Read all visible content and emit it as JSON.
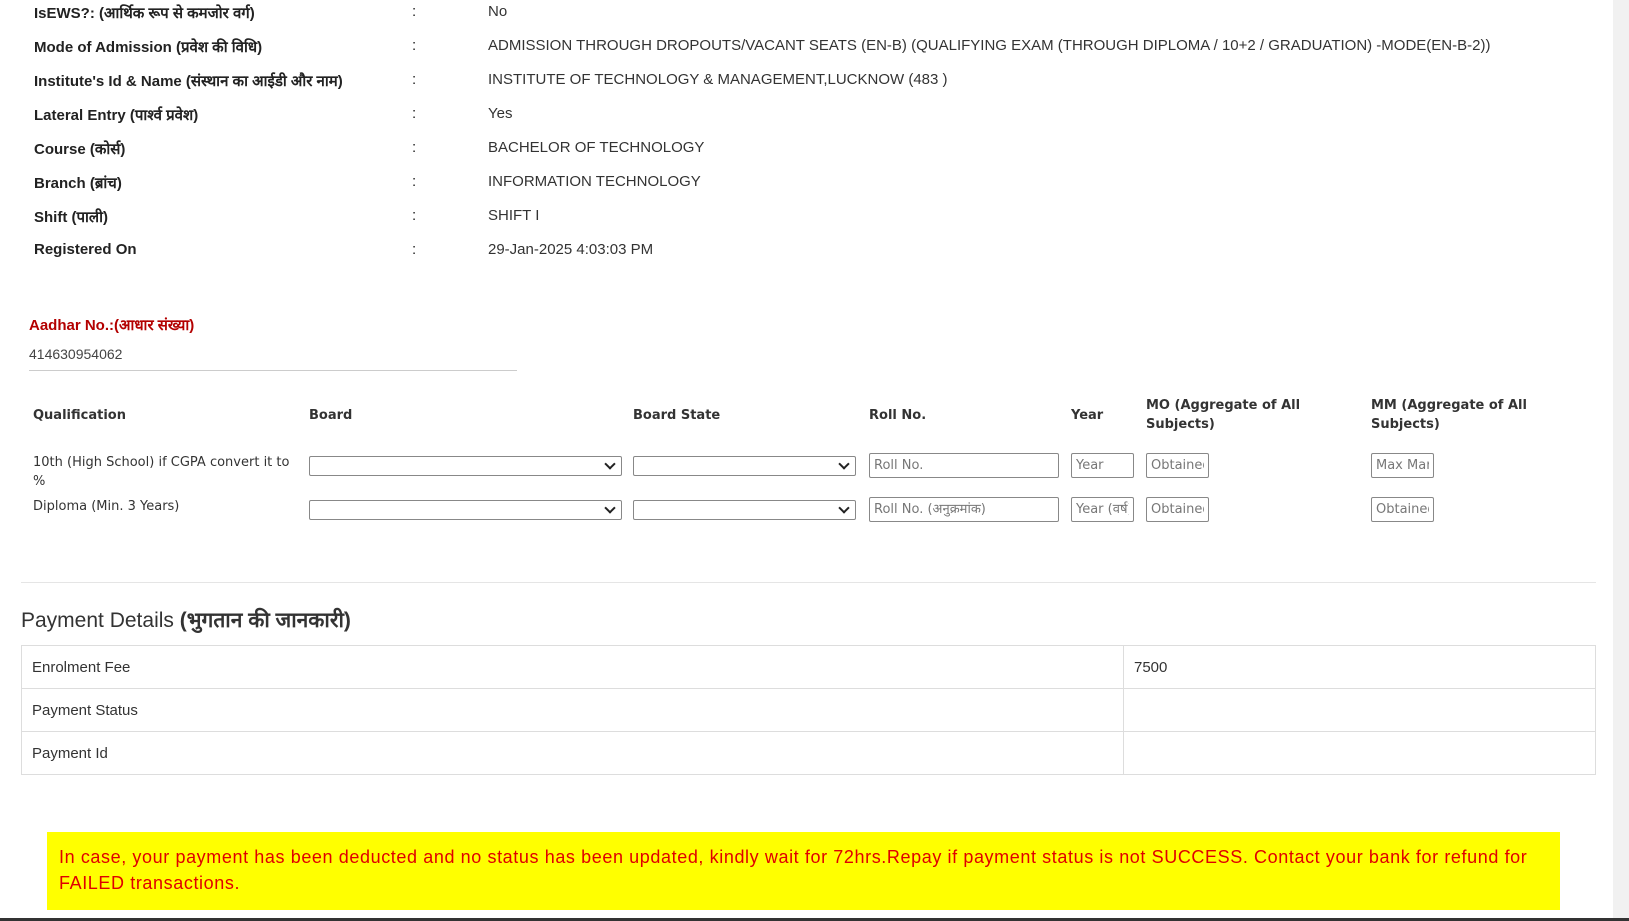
{
  "details": [
    {
      "label": "IsEWS?: (आर्थिक रूप से कमजोर वर्ग)",
      "value": "No"
    },
    {
      "label": "Mode of Admission (प्रवेश की विधि)",
      "value": "ADMISSION THROUGH DROPOUTS/VACANT SEATS (EN-B) (QUALIFYING EXAM (THROUGH DIPLOMA / 10+2 / GRADUATION) -MODE(EN-B-2))"
    },
    {
      "label": "Institute's Id & Name (संस्थान का आईडी और नाम)",
      "value": "INSTITUTE OF TECHNOLOGY & MANAGEMENT,LUCKNOW (483 )"
    },
    {
      "label": "Lateral Entry (पार्श्व प्रवेश)",
      "value": "Yes"
    },
    {
      "label": "Course (कोर्स)",
      "value": "BACHELOR OF TECHNOLOGY"
    },
    {
      "label": "Branch (ब्रांच)",
      "value": "INFORMATION TECHNOLOGY"
    },
    {
      "label": "Shift (पाली)",
      "value": "SHIFT I"
    },
    {
      "label": "Registered On",
      "value": "29-Jan-2025 4:03:03 PM"
    }
  ],
  "colon": ":",
  "aadhar": {
    "label": "Aadhar No.:(आधार संख्या)",
    "value": "414630954062"
  },
  "qualification": {
    "headers": [
      "Qualification",
      "Board",
      "Board State",
      "Roll No.",
      "Year",
      "MO (Aggregate of All Subjects)",
      "MM (Aggregate of All Subjects)"
    ],
    "rows": [
      {
        "name": "10th (High School)  if CGPA convert it to %",
        "roll_ph": "Roll No.",
        "year_ph": "Year",
        "mo_ph": "Obtained",
        "mm_ph": "Max Marks"
      },
      {
        "name": "Diploma (Min. 3 Years)",
        "roll_ph": "Roll No. (अनुक्रमांक)",
        "year_ph": "Year (वर्ष)",
        "mo_ph": "Obtained",
        "mm_ph": "Obtained"
      }
    ]
  },
  "payment": {
    "title": "Payment Details ",
    "title_hindi": "(भुगतान की जानकारी)",
    "rows": [
      {
        "label": "Enrolment Fee",
        "value": "7500"
      },
      {
        "label": "Payment Status",
        "value": ""
      },
      {
        "label": "Payment Id",
        "value": ""
      }
    ]
  },
  "warning": "In case, your payment has been deducted and no status has been updated, kindly wait for 72hrs.Repay if payment status is not SUCCESS. Contact your bank for refund for FAILED transactions.",
  "colors": {
    "warning_bg": "#ffff00",
    "warning_text": "#e00000",
    "aadhar_label": "#b30000"
  }
}
